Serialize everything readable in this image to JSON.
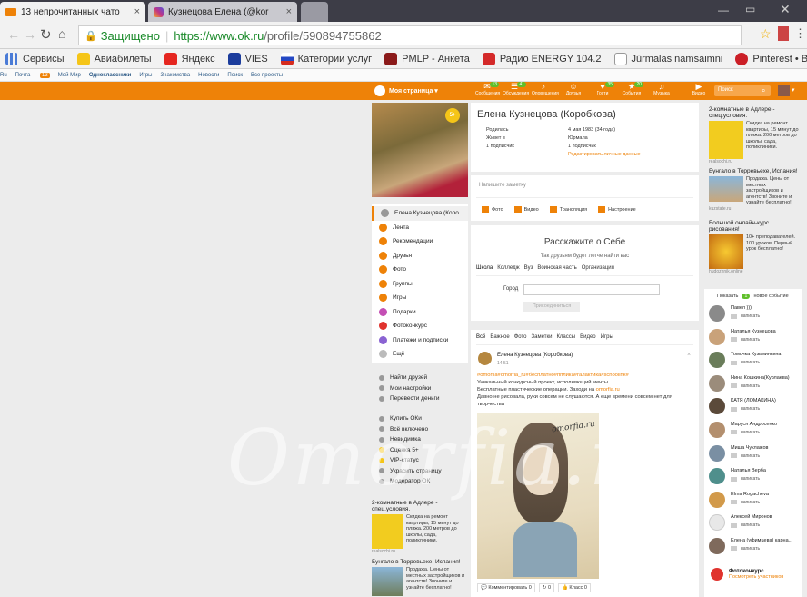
{
  "browser": {
    "tabs": [
      {
        "title": "13 непрочитанных чато",
        "icon": "mail-icon"
      },
      {
        "title": "Кузнецова Елена (@kor",
        "icon": "instagram-icon"
      }
    ],
    "secure_label": "Защищено",
    "url_prefix": "https://www.ok.ru",
    "url_path": "/profile/590894755862",
    "bookmarks": [
      "Сервисы",
      "Авиабилеты",
      "Яндекс",
      "VIES",
      "Категории услуг",
      "PMLP - Анкета",
      "Радио ENERGY 104.2",
      "Jūrmalas namsaimni",
      "Pinterest • Всемирн"
    ]
  },
  "portal_bar": [
    "Ru",
    "Почта",
    "Мой Мир",
    "Одноклассники",
    "Игры",
    "Знакомства",
    "Новости",
    "Поиск",
    "Все проекты"
  ],
  "portal_badge": "13",
  "topbar": {
    "my_page": "Моя страница",
    "items": [
      {
        "label": "Сообщения",
        "badge": "13",
        "icon": "message-icon"
      },
      {
        "label": "Обсуждения",
        "badge": "41",
        "icon": "discussion-icon"
      },
      {
        "label": "Оповещения",
        "badge": "",
        "icon": "bell-icon"
      },
      {
        "label": "Друзья",
        "badge": "",
        "icon": "friends-icon"
      },
      {
        "label": "Гости",
        "badge": "35",
        "icon": "guests-icon"
      },
      {
        "label": "События",
        "badge": "20",
        "icon": "events-icon"
      },
      {
        "label": "Музыка",
        "badge": "",
        "icon": "music-icon"
      },
      {
        "label": "Видео",
        "badge": "",
        "icon": "video-icon"
      }
    ],
    "search_placeholder": "Поиск"
  },
  "profile": {
    "avatar_badge": "5+",
    "name": "Елена Кузнецова (Коробкова)",
    "details": [
      {
        "label": "Родилась",
        "value": "4 мая 1983 (34 года)"
      },
      {
        "label": "Живет в",
        "value": "Юрмала"
      },
      {
        "label": "1 подписчик",
        "value": "1 подписчик"
      }
    ],
    "edit_link": "Редактировать личные данные"
  },
  "status": {
    "placeholder": "Напишите заметку",
    "actions": [
      "Фото",
      "Видео",
      "Трансляция",
      "Настроение"
    ]
  },
  "about": {
    "title": "Расскажите о Себе",
    "subtitle": "Так друзьям будет легче найти вас",
    "tabs": [
      "Школа",
      "Колледж",
      "Вуз",
      "Воинская часть",
      "Организация"
    ],
    "city_label": "Город",
    "join_button": "Присоединиться"
  },
  "feed": {
    "tabs": [
      "Всё",
      "Важное",
      "Фото",
      "Заметки",
      "Классы",
      "Видео",
      "Игры"
    ],
    "post": {
      "author": "Елена Кузнецова (Коробкова)",
      "time": "14:51",
      "hashtags": "#omorfia#omorfia_ru#бесплатно#пплика#галактика#schoolink#",
      "line1": "Уникальный конкурсный проект, исполняющий мечты.",
      "line2_prefix": "Бесплатные пластические операции. Заходи на ",
      "line2_link": "omorfia.ru",
      "line3": "Давно не рисовала, руки совсем не слушаются. А еще времени совсем нет для творчества",
      "image_caption": "omorfia.ru",
      "actions": [
        {
          "label": "Комментировать",
          "count": "0"
        },
        {
          "label": "",
          "count": "0"
        },
        {
          "label": "Класс",
          "count": "0"
        }
      ]
    }
  },
  "left_menu": {
    "profile_item": "Елена Кузнецова (Коро",
    "items": [
      {
        "label": "Лента",
        "color": "#ee8208"
      },
      {
        "label": "Рекомендации",
        "color": "#ee8208"
      },
      {
        "label": "Друзья",
        "color": "#ee8208"
      },
      {
        "label": "Фото",
        "color": "#ee8208"
      },
      {
        "label": "Группы",
        "color": "#ee8208"
      },
      {
        "label": "Игры",
        "color": "#ee8208"
      },
      {
        "label": "Подарки",
        "color": "#c44fb4"
      },
      {
        "label": "Фотоконкурс",
        "color": "#e0332e"
      },
      {
        "label": "Платежи и подписки",
        "color": "#8a63d2"
      },
      {
        "label": "Ещё",
        "color": "#bbbbbb"
      }
    ],
    "links1": [
      "Найти друзей",
      "Мои настройки",
      "Перевести деньги"
    ],
    "links2": [
      "Купить ОКи",
      "Всё включено",
      "Невидимка",
      "Оценка 5+",
      "VIP-статус",
      "Украсить страницу",
      "Модератор ОК"
    ]
  },
  "left_ads": [
    {
      "title": "2-комнатные в Адлере - спец.условия.",
      "text": "Скидка на ремонт квартиры, 15 минут до пляжа. 200 метров до школы, сада, поликлиники.",
      "src": "realsochi.ru"
    },
    {
      "title": "Бунгало в Торревьехе, Испания!",
      "text": "Продажа. Цены от местных застройщиков и агентств! Звоните и узнайте бесплатно!",
      "src": ""
    }
  ],
  "right_ads": [
    {
      "title": "2-комнатные в Адлере - спец.условия.",
      "text": "Скидка на ремонт квартиры, 15 минут до пляжа. 200 метров до школы, сада, поликлиники.",
      "src": "realsochi.ru"
    },
    {
      "title": "Бунгало в Торревьехе, Испания!",
      "text": "Продажа. Цены от местных застройщиков и агентств! Звоните и узнайте бесплатно!",
      "src": "kuzstate.ru"
    },
    {
      "title": "Большой онлайн-курс рисования!",
      "text": "10+ преподавателей. 100 уроков. Первый урок бесплатно!",
      "src": "hudozhnik.online"
    }
  ],
  "friends": {
    "show_label": "Показать",
    "show_count": "1",
    "show_suffix": "новое событие",
    "write_label": "написать",
    "list": [
      {
        "name": "Павел )))",
        "color": "#8a8a8a"
      },
      {
        "name": "Наталья Кузнецова",
        "color": "#c9a27a"
      },
      {
        "name": "Томочка Кузьминкина",
        "color": "#6a7d5a"
      },
      {
        "name": "Нина Кошкина(Курлаева)",
        "color": "#9b8c7b"
      },
      {
        "name": "КАТЯ (ЛОМАКИНА)",
        "color": "#5b4a3a"
      },
      {
        "name": "Маруся Андросенко",
        "color": "#b38f6e"
      },
      {
        "name": "Миша Чуклажов",
        "color": "#7a8fa3"
      },
      {
        "name": "Наталья Верба",
        "color": "#4f8f8c"
      },
      {
        "name": "Elma Rogacheva",
        "color": "#d29a4a"
      },
      {
        "name": "Алексей Миронов",
        "color": "#e8e8e8"
      },
      {
        "name": "Елена (уфимцева) карна...",
        "color": "#7f6a5c"
      }
    ]
  },
  "photo_contest": {
    "title": "Фотоконкурс",
    "link": "Посмотреть участников"
  },
  "watermark": "Omorfia.ru"
}
